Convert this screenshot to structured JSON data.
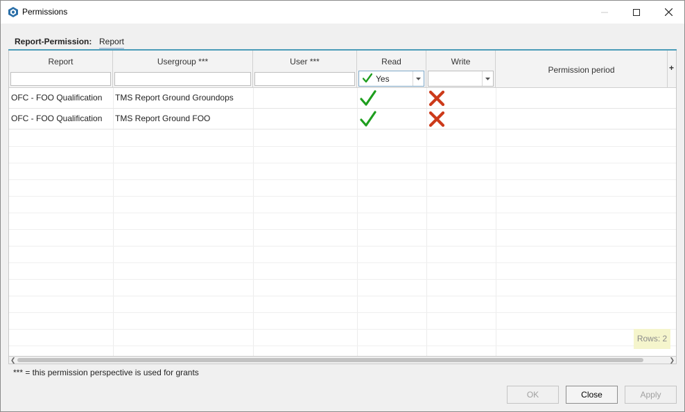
{
  "window": {
    "title": "Permissions"
  },
  "tabs": {
    "caption": "Report-Permission:",
    "active": "Report"
  },
  "columns": {
    "report": "Report",
    "usergroup": "Usergroup ***",
    "user": "User ***",
    "read": "Read",
    "write": "Write",
    "period": "Permission period",
    "add": "+"
  },
  "filters": {
    "read_selected": "Yes",
    "write_selected": ""
  },
  "rows": [
    {
      "report": "OFC - FOO Qualification",
      "usergroup": "TMS Report Ground Groundops",
      "user": "",
      "read": "check-icon",
      "write": "cross-icon",
      "period": ""
    },
    {
      "report": "OFC - FOO Qualification",
      "usergroup": "TMS Report Ground FOO",
      "user": "",
      "read": "check-icon",
      "write": "cross-icon",
      "period": ""
    }
  ],
  "rows_count": "Rows: 2",
  "footnote": "*** = this permission perspective is used for grants",
  "buttons": {
    "ok": "OK",
    "close": "Close",
    "apply": "Apply"
  },
  "colors": {
    "accent": "#4a9bb8",
    "check": "#1e9e1e",
    "cross": "#cc3a1a",
    "badge": "#f5f5cc"
  }
}
